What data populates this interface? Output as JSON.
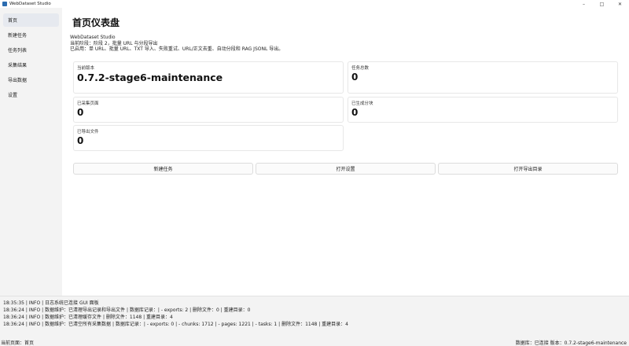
{
  "window": {
    "title": "WebDataset Studio",
    "minimize_icon": "minimize-icon",
    "maximize_icon": "maximize-icon",
    "close_icon": "close-icon"
  },
  "sidebar": {
    "items": [
      {
        "label": "首页",
        "active": true
      },
      {
        "label": "新建任务"
      },
      {
        "label": "任务列表"
      },
      {
        "label": "采集结果"
      },
      {
        "label": "导出数据"
      },
      {
        "label": "设置"
      }
    ]
  },
  "main": {
    "title": "首页仪表盘",
    "info_lines": [
      "WebDataset Studio",
      "当前阶段：阶段 2，批量 URL 与分段导出",
      "已启用：单 URL、批量 URL、TXT 导入、失败重试、URL/正文去重、自动分段和 RAG JSONL 导出。"
    ],
    "cards": {
      "version": {
        "label": "当前版本",
        "value": "0.7.2-stage6-maintenance"
      },
      "tasks": {
        "label": "任务总数",
        "value": "0"
      },
      "pages": {
        "label": "已采集页面",
        "value": "0"
      },
      "chunks": {
        "label": "已生成分块",
        "value": "0"
      },
      "exports": {
        "label": "已导出文件",
        "value": "0"
      }
    },
    "buttons": {
      "new_task": "新建任务",
      "open_settings": "打开设置",
      "open_export_dir": "打开导出目录"
    }
  },
  "log": {
    "lines": [
      "18:35:35 | INFO | 日志系统已连接 GUI 面板",
      "18:36:24 | INFO | 数据维护：已清理导出记录和导出文件 | 数据库记录：| - exports: 2 | 删除文件：0 | 重建目录：0",
      "18:36:24 | INFO | 数据维护：已清理缓存文件 | 删除文件：1148 | 重建目录：4",
      "18:36:24 | INFO | 数据维护：已清空所有采集数据 | 数据库记录：| - exports: 0 | - chunks: 1712 | - pages: 1221 | - tasks: 1 | 删除文件：1148 | 重建目录：4"
    ]
  },
  "status": {
    "left": "当前页面：首页",
    "right": "数据库：已连接  版本：0.7.2-stage6-maintenance"
  }
}
